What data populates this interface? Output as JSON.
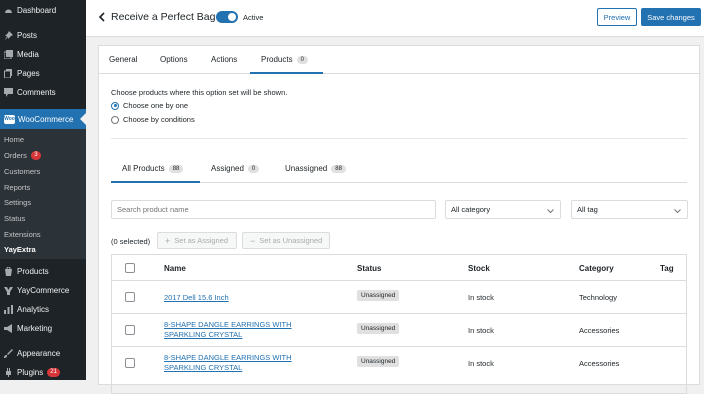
{
  "sidebar": {
    "items": [
      {
        "label": "Dashboard",
        "icon": "dashboard-icon"
      },
      {
        "label": "Posts",
        "icon": "pin-icon"
      },
      {
        "label": "Media",
        "icon": "media-icon"
      },
      {
        "label": "Pages",
        "icon": "pages-icon"
      },
      {
        "label": "Comments",
        "icon": "comments-icon"
      },
      {
        "label": "WooCommerce",
        "icon": "woo-icon",
        "icon_text": "Woo"
      },
      {
        "label": "Products",
        "icon": "products-icon"
      },
      {
        "label": "YayCommerce",
        "icon": "yaycommerce-icon"
      },
      {
        "label": "Analytics",
        "icon": "analytics-icon"
      },
      {
        "label": "Marketing",
        "icon": "marketing-icon"
      },
      {
        "label": "Appearance",
        "icon": "appearance-icon"
      },
      {
        "label": "Plugins",
        "icon": "plugins-icon",
        "badge": "21"
      }
    ],
    "submenu": [
      {
        "label": "Home"
      },
      {
        "label": "Orders",
        "badge": "3"
      },
      {
        "label": "Customers"
      },
      {
        "label": "Reports"
      },
      {
        "label": "Settings"
      },
      {
        "label": "Status"
      },
      {
        "label": "Extensions"
      },
      {
        "label": "YayExtra"
      }
    ]
  },
  "header": {
    "title": "Receive a Perfect Bag",
    "toggle_label": "Active",
    "preview_label": "Preview",
    "save_label": "Save changes"
  },
  "tabs": [
    {
      "label": "General"
    },
    {
      "label": "Options"
    },
    {
      "label": "Actions"
    },
    {
      "label": "Products",
      "count": "0"
    }
  ],
  "products_panel": {
    "choose_text": "Choose products where this option set will be shown.",
    "radio_one": "Choose one by one",
    "radio_conditions": "Choose by conditions",
    "subtabs": [
      {
        "label": "All Products",
        "count": "88"
      },
      {
        "label": "Assigned",
        "count": "0"
      },
      {
        "label": "Unassigned",
        "count": "88"
      }
    ],
    "search_placeholder": "Search product name",
    "category_select": "All category",
    "tag_select": "All tag",
    "selected_count": "(0 selected)",
    "set_assigned": "Set as Assigned",
    "set_unassigned": "Set as Unassigned"
  },
  "table": {
    "headers": {
      "name": "Name",
      "status": "Status",
      "stock": "Stock",
      "category": "Category",
      "tag": "Tag"
    },
    "rows": [
      {
        "name": "2017 Dell 15.6 Inch",
        "status": "Unassigned",
        "stock": "In stock",
        "category": "Technology"
      },
      {
        "name_line1": "8-SHAPE DANGLE EARRINGS WITH",
        "name_line2": "SPARKLING CRYSTAL",
        "status": "Unassigned",
        "stock": "In stock",
        "category": "Accessories"
      },
      {
        "name_line1": "8-SHAPE DANGLE EARRINGS WITH",
        "name_line2": "SPARKLING CRYSTAL",
        "status": "Unassigned",
        "stock": "In stock",
        "category": "Accessories"
      }
    ]
  },
  "colors": {
    "accent": "#2271b1",
    "sidebar_bg": "#1d2327",
    "badge_red": "#d63638"
  }
}
